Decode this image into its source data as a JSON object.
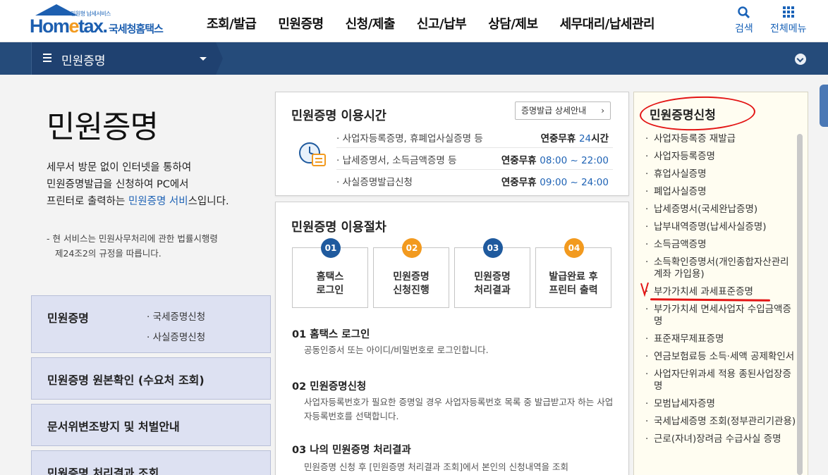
{
  "header": {
    "logo_small": "민원형 납세서비스",
    "logo_main_1": "Hom",
    "logo_main_e": "e",
    "logo_main_2": "tax.",
    "logo_korean": "국세청홈택스",
    "nav": [
      "조회/발급",
      "민원증명",
      "신청/제출",
      "신고/납부",
      "상담/제보",
      "세무대리/납세관리"
    ],
    "search_label": "검색",
    "all_menu_label": "전체메뉴"
  },
  "subnav": {
    "title": "민원증명"
  },
  "intro": {
    "title": "민원증명",
    "line1": "세무서 방문 없이 인터넷을 통하여",
    "line2": "민원증명발급을 신청하여 PC에서",
    "line3_pre": "프린터로 출력하는 ",
    "line3_link": "민원증명 서비",
    "line3_post": "스입니다.",
    "note_line1": "- 현 서비스는 민원사무처리에 관한 법률시행령",
    "note_line2": "제24조2의 규정을 따릅니다."
  },
  "left_menu": {
    "first_title": "민원증명",
    "first_subs": [
      "국세증명신청",
      "사실증명신청"
    ],
    "items": [
      "민원증명 원본확인 (수요처 조회)",
      "문서위변조방지 및 처벌안내",
      "민원증명 처리결과 조회"
    ]
  },
  "usage_time": {
    "title": "민원증명 이용시간",
    "guide_button": "증명발급 상세안내",
    "rows": [
      {
        "label": "사업자등록증명, 휴폐업사실증명 등",
        "val_pre": "연중무휴 ",
        "val_hl": "24",
        "val_post": "시간"
      },
      {
        "label": "납세증명서, 소득금액증명 등",
        "val_pre": "연중무휴 ",
        "val_hl": "08:00 ~ 22:00",
        "val_post": ""
      },
      {
        "label": "사실증명발급신청",
        "val_pre": "연중무휴 ",
        "val_hl": "09:00 ~ 24:00",
        "val_post": ""
      }
    ]
  },
  "procedure": {
    "title": "민원증명 이용절차",
    "steps": [
      {
        "num": "01",
        "line1": "홈택스",
        "line2": "로그인",
        "color": "#1f5a9e"
      },
      {
        "num": "02",
        "line1": "민원증명",
        "line2": "신청진행",
        "color": "#f29a1f"
      },
      {
        "num": "03",
        "line1": "민원증명",
        "line2": "처리결과",
        "color": "#1f5a9e"
      },
      {
        "num": "04",
        "line1": "발급완료 후",
        "line2": "프린터 출력",
        "color": "#f29a1f"
      }
    ],
    "details": [
      {
        "head": "01 홈택스 로그인",
        "desc": "공동인증서 또는 아이디/비밀번호로 로그인합니다."
      },
      {
        "head": "02 민원증명신청",
        "desc": "사업자등록번호가 필요한 증명일 경우 사업자등록번호 목록 중 발급받고자 하는 사업자등록번호를 선택합니다."
      },
      {
        "head": "03 나의 민원증명 처리결과",
        "desc": "민원증명 신청 후 [민원증명 처리결과 조회]에서 본인의 신청내역을 조회"
      }
    ]
  },
  "right_panel": {
    "title": "민원증명신청",
    "items": [
      "사업자등록증 재발급",
      "사업자등록증명",
      "휴업사실증명",
      "폐업사실증명",
      "납세증명서(국세완납증명)",
      "납부내역증명(납세사실증명)",
      "소득금액증명",
      "소득확인증명서(개인종합자산관리계좌 가입용)",
      "부가가치세 과세표준증명",
      "부가가치세 면세사업자 수입금액증명",
      "표준재무제표증명",
      "연금보험료등 소득·세액 공제확인서",
      "사업자단위과세 적용 종된사업장증명",
      "모범납세자증명",
      "국세납세증명 조회(정부관리기관용)",
      "근로(자녀)장려금 수급사실 증명"
    ]
  },
  "colors": {
    "navy": "#254b7a",
    "accent_blue": "#1f63b5",
    "orange": "#f29a1f",
    "annotation_red": "#e31414"
  }
}
